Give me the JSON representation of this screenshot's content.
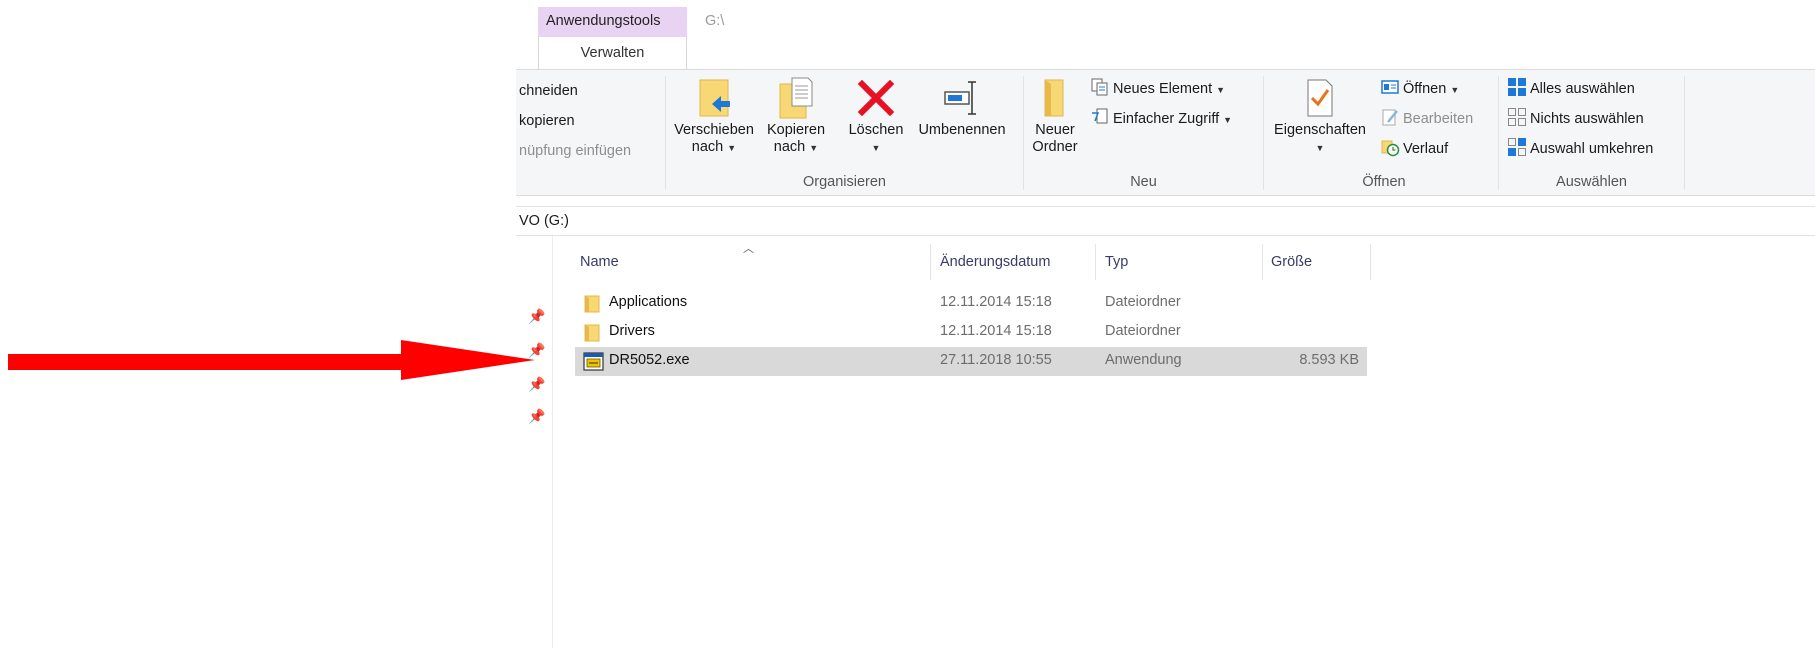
{
  "titlebar": {
    "context_tab": "Anwendungstools",
    "path": "G:\\"
  },
  "ribbon": {
    "active_tab": "Verwalten",
    "clipboard": {
      "cut": "chneiden",
      "copy_path": "kopieren",
      "paste_shortcut": "nüpfung einfügen"
    },
    "organize": {
      "move_to_l1": "Verschieben",
      "move_to_l2": "nach",
      "copy_to_l1": "Kopieren",
      "copy_to_l2": "nach",
      "delete": "Löschen",
      "rename": "Umbenennen",
      "group_label": "Organisieren"
    },
    "new": {
      "new_folder_l1": "Neuer",
      "new_folder_l2": "Ordner",
      "new_item": "Neues Element",
      "easy_access": "Einfacher Zugriff",
      "group_label": "Neu"
    },
    "open": {
      "properties": "Eigenschaften",
      "open": "Öffnen",
      "edit": "Bearbeiten",
      "history": "Verlauf",
      "group_label": "Öffnen"
    },
    "select": {
      "select_all": "Alles auswählen",
      "select_none": "Nichts auswählen",
      "invert": "Auswahl umkehren",
      "group_label": "Auswählen"
    }
  },
  "address_bar": {
    "text": "VO (G:)"
  },
  "file_list": {
    "columns": {
      "name": "Name",
      "date": "Änderungsdatum",
      "type": "Typ",
      "size": "Größe"
    },
    "rows": [
      {
        "name": "Applications",
        "date": "12.11.2014 15:18",
        "type": "Dateiordner",
        "size": "",
        "icon": "folder-icon",
        "selected": false
      },
      {
        "name": "Drivers",
        "date": "12.11.2014 15:18",
        "type": "Dateiordner",
        "size": "",
        "icon": "folder-icon",
        "selected": false
      },
      {
        "name": "DR5052.exe",
        "date": "27.11.2018 10:55",
        "type": "Anwendung",
        "size": "8.593 KB",
        "icon": "application-icon",
        "selected": true
      }
    ]
  },
  "annotation": {
    "arrow_color": "#ff0000",
    "icon": "red-arrow"
  },
  "colors": {
    "context_tab_bg": "#e9d3f3",
    "ribbon_bg": "#f5f6f7",
    "selected_row_bg": "#d9d9d9",
    "folder_yellow": "#f8d775",
    "delete_red": "#e81123",
    "accent_blue": "#1e78d7"
  }
}
